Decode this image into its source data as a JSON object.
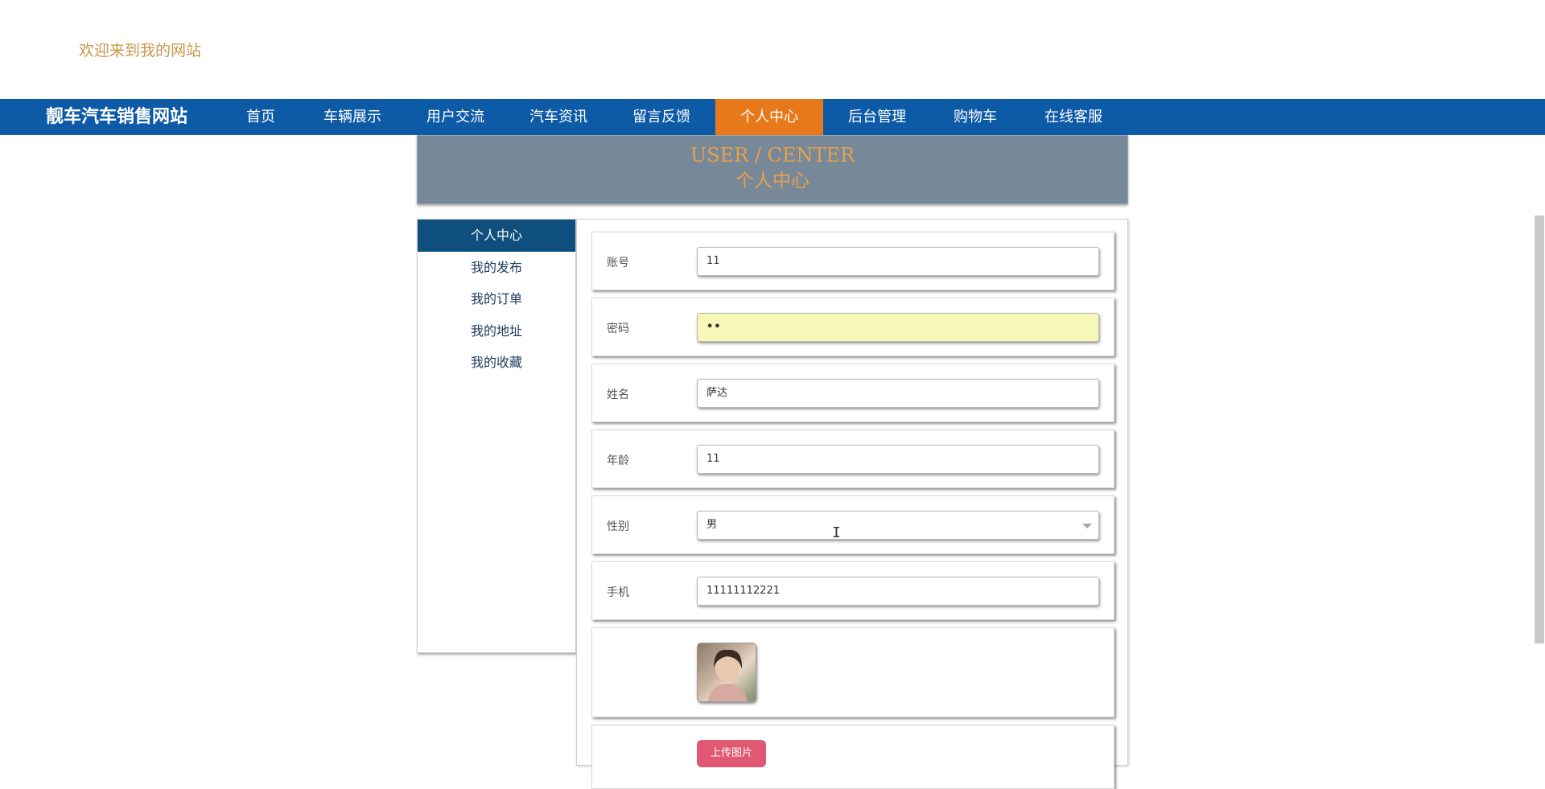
{
  "header": {
    "welcome": "欢迎来到我的网站"
  },
  "navbar": {
    "brand": "靓车汽车销售网站",
    "items": [
      {
        "label": "首页"
      },
      {
        "label": "车辆展示"
      },
      {
        "label": "用户交流"
      },
      {
        "label": "汽车资讯"
      },
      {
        "label": "留言反馈"
      },
      {
        "label": "个人中心"
      },
      {
        "label": "后台管理"
      },
      {
        "label": "购物车"
      },
      {
        "label": "在线客服"
      }
    ],
    "active_index": 5
  },
  "banner": {
    "title_en": "USER / CENTER",
    "title_cn": "个人中心"
  },
  "sidebar": {
    "items": [
      {
        "label": "个人中心"
      },
      {
        "label": "我的发布"
      },
      {
        "label": "我的订单"
      },
      {
        "label": "我的地址"
      },
      {
        "label": "我的收藏"
      }
    ],
    "active_index": 0
  },
  "form": {
    "account": {
      "label": "账号",
      "value": "11"
    },
    "password": {
      "label": "密码",
      "value": "••"
    },
    "name": {
      "label": "姓名",
      "value": "萨达"
    },
    "age": {
      "label": "年龄",
      "value": "11"
    },
    "gender": {
      "label": "性别",
      "value": "男"
    },
    "phone": {
      "label": "手机",
      "value": "11111112221"
    },
    "upload_label": "上传图片"
  },
  "icons": {
    "avatar": "avatar-photo",
    "select": "chevron-down-icon",
    "cursor": "text-cursor-icon"
  },
  "colors": {
    "nav_bg": "#0d5aa7",
    "nav_active": "#e8791a",
    "banner_bg": "#778899",
    "banner_text": "#e8a14a",
    "sidebar_active": "#0e4f7d",
    "upload_btn": "#e05872",
    "welcome": "#c8964a"
  }
}
